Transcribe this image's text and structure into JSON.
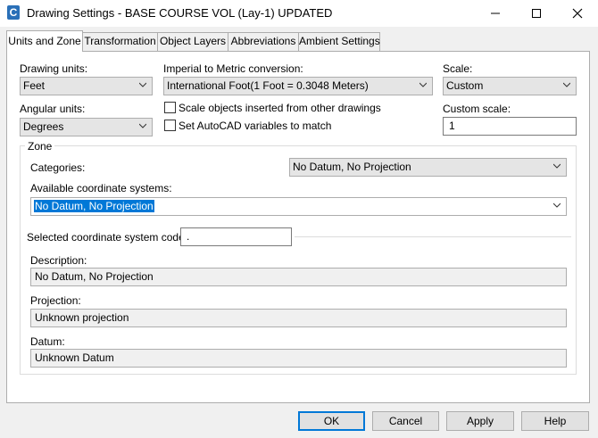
{
  "window": {
    "title": "Drawing Settings - BASE COURSE VOL (Lay-1) UPDATED",
    "icon_letter": "C",
    "icons": [
      "app-icon",
      "minimize-icon",
      "maximize-icon",
      "close-icon"
    ]
  },
  "tabs": [
    {
      "label": "Units and Zone",
      "active": true
    },
    {
      "label": "Transformation",
      "active": false
    },
    {
      "label": "Object Layers",
      "active": false
    },
    {
      "label": "Abbreviations",
      "active": false
    },
    {
      "label": "Ambient Settings",
      "active": false
    }
  ],
  "units": {
    "drawing_units_label": "Drawing units:",
    "drawing_units_value": "Feet",
    "angular_units_label": "Angular units:",
    "angular_units_value": "Degrees",
    "conversion_label": "Imperial to Metric conversion:",
    "conversion_value": "International Foot(1 Foot = 0.3048 Meters)",
    "scale_objects_label": "Scale objects inserted from other drawings",
    "scale_objects_checked": false,
    "set_vars_label": "Set AutoCAD variables to match",
    "set_vars_checked": false,
    "scale_label": "Scale:",
    "scale_value": "Custom",
    "custom_scale_label": "Custom scale:",
    "custom_scale_value": "1"
  },
  "zone": {
    "group_label": "Zone",
    "categories_label": "Categories:",
    "categories_value": "No Datum, No Projection",
    "available_label": "Available coordinate systems:",
    "available_value": "No Datum, No Projection",
    "code_label": "Selected coordinate system code:",
    "code_value": ".",
    "description_label": "Description:",
    "description_value": "No Datum, No Projection",
    "projection_label": "Projection:",
    "projection_value": "Unknown projection",
    "datum_label": "Datum:",
    "datum_value": "Unknown Datum"
  },
  "buttons": {
    "ok": "OK",
    "cancel": "Cancel",
    "apply": "Apply",
    "help": "Help"
  },
  "colors": {
    "accent": "#0078d7",
    "selection": "#0078d7"
  }
}
